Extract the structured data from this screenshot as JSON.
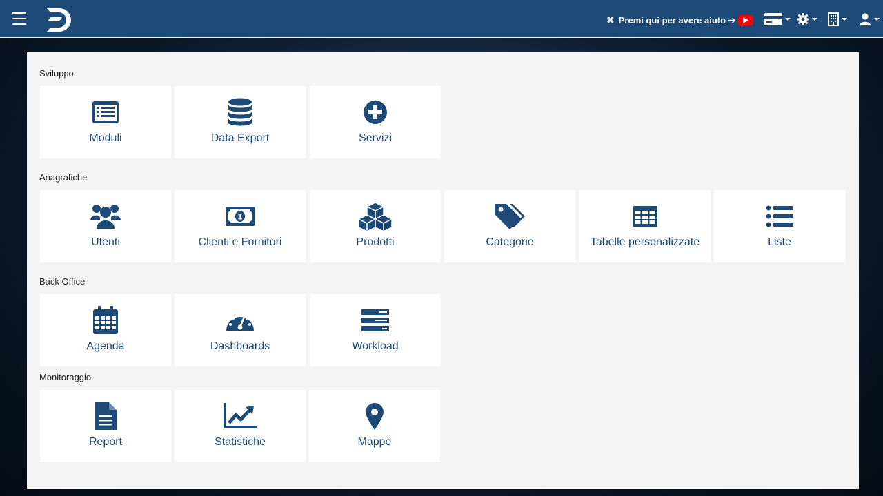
{
  "header": {
    "menu_icon": "hamburger-icon",
    "logo_icon": "app-logo",
    "help_close_icon": "x-icon",
    "help_text": "Premi qui per avere aiuto",
    "help_arrow_icon": "arrow-right-icon",
    "help_video_icon": "youtube-icon",
    "right_icons": [
      "card-icon",
      "gear-icon",
      "building-icon",
      "user-icon"
    ],
    "colors": {
      "bar": "#1e4a78",
      "accent": "#1e4a78",
      "youtube": "#ff0000"
    }
  },
  "sections": [
    {
      "title": "Sviluppo",
      "tiles": [
        {
          "label": "Moduli",
          "icon": "list-alt-icon"
        },
        {
          "label": "Data Export",
          "icon": "database-icon"
        },
        {
          "label": "Servizi",
          "icon": "plus-circle-icon"
        }
      ]
    },
    {
      "title": "Anagrafiche",
      "tiles": [
        {
          "label": "Utenti",
          "icon": "users-icon"
        },
        {
          "label": "Clienti e Fornitori",
          "icon": "money-bill-icon"
        },
        {
          "label": "Prodotti",
          "icon": "cubes-icon"
        },
        {
          "label": "Categorie",
          "icon": "tags-icon"
        },
        {
          "label": "Tabelle personalizzate",
          "icon": "table-icon"
        },
        {
          "label": "Liste",
          "icon": "list-icon"
        }
      ]
    },
    {
      "title": "Back Office",
      "tiles": [
        {
          "label": "Agenda",
          "icon": "calendar-icon"
        },
        {
          "label": "Dashboards",
          "icon": "tachometer-icon"
        },
        {
          "label": "Workload",
          "icon": "tasks-icon"
        }
      ]
    },
    {
      "title": "Monitoraggio",
      "tiles": [
        {
          "label": "Report",
          "icon": "file-text-icon"
        },
        {
          "label": "Statistiche",
          "icon": "chart-line-icon"
        },
        {
          "label": "Mappe",
          "icon": "map-marker-icon"
        }
      ]
    }
  ]
}
